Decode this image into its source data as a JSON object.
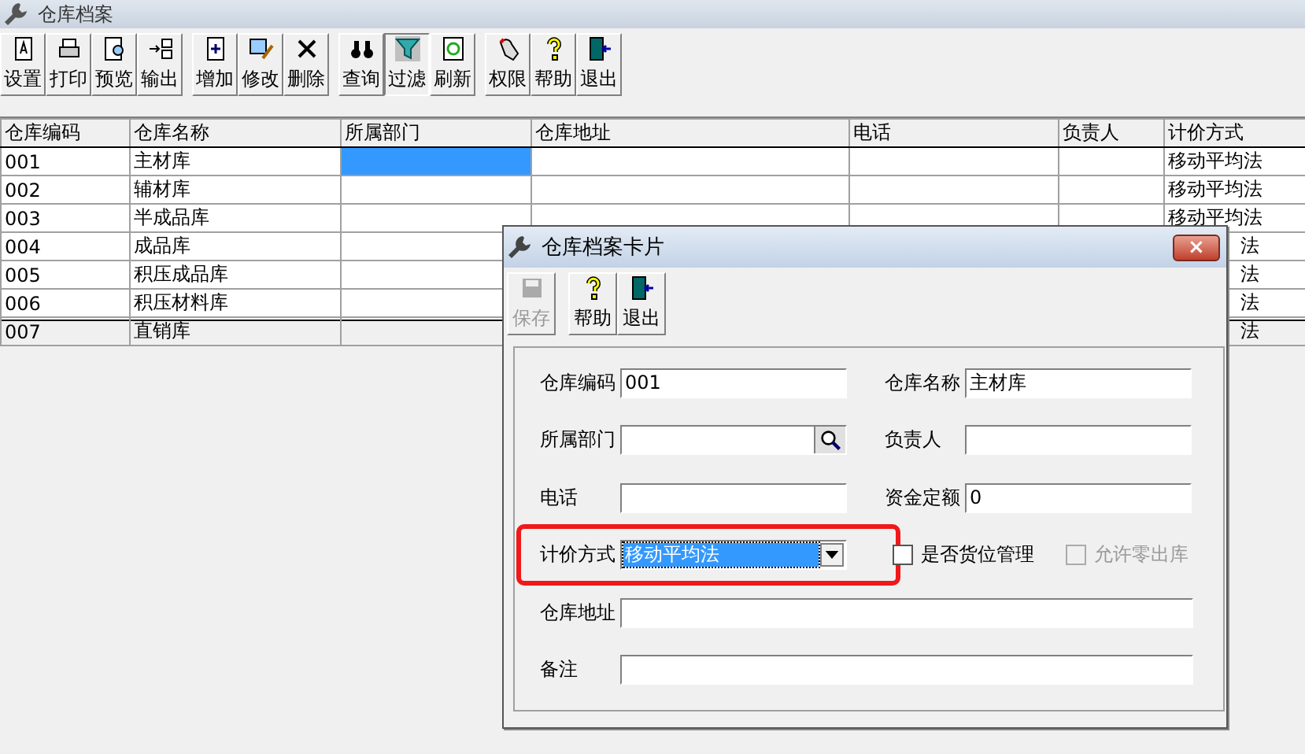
{
  "window": {
    "title": "仓库档案"
  },
  "toolbar": [
    [
      {
        "label": "设置",
        "pressed": false
      },
      {
        "label": "打印",
        "pressed": false
      },
      {
        "label": "预览",
        "pressed": false
      },
      {
        "label": "输出",
        "pressed": false
      }
    ],
    [
      {
        "label": "增加",
        "pressed": false
      },
      {
        "label": "修改",
        "pressed": false
      },
      {
        "label": "删除",
        "pressed": false
      }
    ],
    [
      {
        "label": "查询",
        "pressed": false
      },
      {
        "label": "过滤",
        "pressed": true
      },
      {
        "label": "刷新",
        "pressed": false
      }
    ],
    [
      {
        "label": "权限",
        "pressed": false
      },
      {
        "label": "帮助",
        "pressed": false
      },
      {
        "label": "退出",
        "pressed": false
      }
    ]
  ],
  "table": {
    "columns": [
      "仓库编码",
      "仓库名称",
      "所属部门",
      "仓库地址",
      "电话",
      "负责人",
      "计价方式"
    ],
    "rows": [
      {
        "partial": false,
        "cells": [
          {
            "text": "001",
            "selected": false
          },
          {
            "text": "主材库",
            "selected": false
          },
          {
            "selected": true
          },
          {
            "selected": false
          },
          {
            "selected": false
          },
          {
            "selected": false
          },
          {
            "text": "移动平均法",
            "selected": false
          }
        ]
      },
      {
        "partial": false,
        "cells": [
          {
            "text": "002",
            "selected": false
          },
          {
            "text": "辅材库",
            "selected": false
          },
          {
            "selected": false
          },
          {
            "selected": false
          },
          {
            "selected": false
          },
          {
            "selected": false
          },
          {
            "text": "移动平均法",
            "selected": false
          }
        ]
      },
      {
        "partial": false,
        "cells": [
          {
            "text": "003",
            "selected": false
          },
          {
            "text": "半成品库",
            "selected": false
          },
          {
            "selected": false
          },
          {
            "selected": false
          },
          {
            "selected": false
          },
          {
            "selected": false
          },
          {
            "text": "移动平均法",
            "selected": false
          }
        ]
      },
      {
        "partial": true,
        "cells": [
          {
            "text": "004",
            "selected": false
          },
          {
            "text": "成品库",
            "selected": false
          },
          {
            "selected": false
          },
          {
            "text": "法",
            "selected": false
          }
        ]
      },
      {
        "partial": true,
        "cells": [
          {
            "text": "005",
            "selected": false
          },
          {
            "text": "积压成品库",
            "selected": false
          },
          {
            "selected": false
          },
          {
            "text": "法",
            "selected": false
          }
        ]
      },
      {
        "partial": true,
        "cells": [
          {
            "text": "006",
            "selected": false
          },
          {
            "text": "积压材料库",
            "selected": false
          },
          {
            "selected": false
          },
          {
            "text": "法",
            "selected": false
          }
        ]
      },
      {
        "partial": true,
        "cells": [
          {
            "text": "007",
            "selected": false
          },
          {
            "text": "直销库",
            "selected": false
          },
          {
            "selected": false
          },
          {
            "text": "法",
            "selected": false
          }
        ]
      }
    ]
  },
  "dialog": {
    "title": "仓库档案卡片",
    "close": "×",
    "toolbar": [
      {
        "label": "保存",
        "disabled": true
      },
      {
        "label": "帮助",
        "disabled": false
      },
      {
        "label": "退出",
        "disabled": false
      }
    ],
    "rows": [
      [
        {
          "kind": "text",
          "label": "仓库编码",
          "value": "001"
        },
        {
          "kind": "text",
          "label": "仓库名称",
          "value": "主材库"
        }
      ],
      [
        {
          "kind": "lookup",
          "label": "所属部门"
        },
        {
          "kind": "text",
          "label": "负责人"
        }
      ],
      [
        {
          "kind": "text",
          "label": "电话"
        },
        {
          "kind": "text",
          "label": "资金定额",
          "value": "0"
        }
      ],
      [
        {
          "kind": "combo",
          "label": "计价方式",
          "value": "移动平均法",
          "highlighted": true
        },
        {
          "kind": "checkbox",
          "label": "是否货位管理",
          "checked": false,
          "disabled": false
        },
        {
          "kind": "checkbox",
          "label": "允许零出库",
          "checked": false,
          "disabled": true
        }
      ],
      [
        {
          "kind": "wide",
          "label": "仓库地址"
        }
      ],
      [
        {
          "kind": "wide",
          "label": "备注"
        }
      ]
    ]
  }
}
